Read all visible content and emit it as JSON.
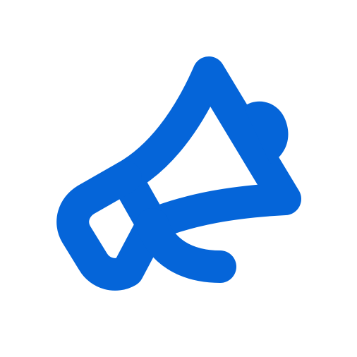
{
  "icon": {
    "name": "megaphone-icon",
    "color": "#0565d9"
  },
  "background": {
    "color": "#ffffff"
  }
}
